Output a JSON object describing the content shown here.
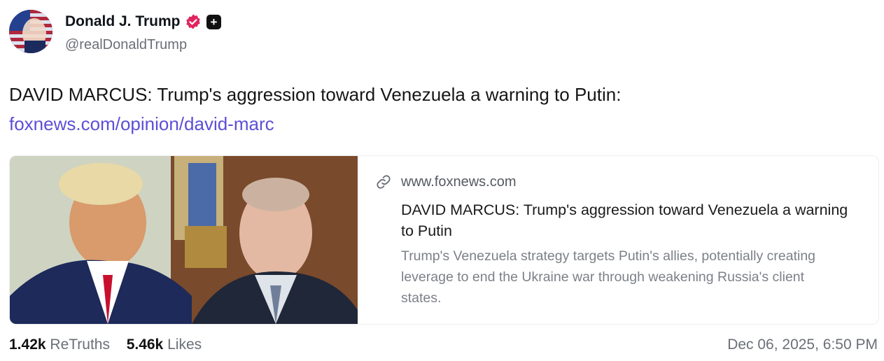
{
  "author": {
    "name": "Donald J. Trump",
    "handle": "@realDonaldTrump"
  },
  "post": {
    "text": "DAVID MARCUS: Trump's aggression toward Venezuela a warning to Putin:",
    "link_text": "foxnews.com/opinion/david-marc"
  },
  "card": {
    "domain": "www.foxnews.com",
    "title": "DAVID MARCUS: Trump's aggression toward Venezuela a warning to Putin",
    "description": "Trump's Venezuela strategy targets Putin's allies, potentially creating leverage to end the Ukraine war through weakening Russia's client states."
  },
  "stats": {
    "retruths_count": "1.42k",
    "retruths_label": "ReTruths",
    "likes_count": "5.46k",
    "likes_label": "Likes"
  },
  "timestamp": "Dec 06, 2025, 6:50 PM",
  "colors": {
    "link": "#5b4fd6",
    "verified_badge": "#e0245e",
    "muted_text": "#6b6f76"
  },
  "icons": {
    "verified": "verified-badge-icon",
    "plus": "plus-badge-icon",
    "link": "link-icon"
  }
}
